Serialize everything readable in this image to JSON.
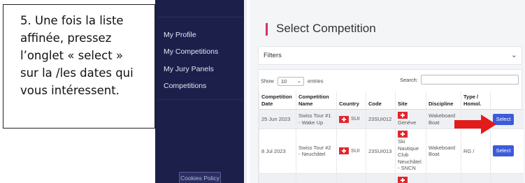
{
  "callout": {
    "lines": [
      "5. Une fois la liste",
      "affinée, pressez",
      "l’onglet « select »",
      "sur la /les dates qui",
      "vous intéressent."
    ]
  },
  "sidebar": {
    "items": [
      {
        "label": "My Profile"
      },
      {
        "label": "My Competitions"
      },
      {
        "label": "My Jury Panels"
      },
      {
        "label": "Competitions"
      }
    ],
    "cookies_label": "Cookies Policy"
  },
  "main": {
    "title": "Select Competition",
    "filters_label": "Filters",
    "show_label": "Show",
    "page_size": "10",
    "entries_label": "entries",
    "search_label": "Search:"
  },
  "table": {
    "headers": [
      "Competition Date",
      "Competition Name",
      "Country",
      "Code",
      "Site",
      "Discipline",
      "Type / Homol.",
      ""
    ],
    "rows": [
      {
        "date": "25 Jun 2023",
        "name": "Swiss Tour #1 - Wake Up",
        "country": "SUI",
        "code": "23SUI012",
        "site": "Genève",
        "discipline": "Wakeboard Boat",
        "type": "",
        "action": "Select"
      },
      {
        "date": "8 Jul 2023",
        "name": "Swiss Tour #2 - Neuchâtel",
        "country": "SUI",
        "code": "23SUI013",
        "site": "Ski Nautique Club Neuchâtel - SNCN",
        "discipline": "Wakeboard Boat",
        "type": "RG /",
        "action": "Select"
      }
    ]
  },
  "colors": {
    "sidebar_bg": "#1b1f4a",
    "accent": "#d0336a",
    "button": "#3d5bd9",
    "arrow": "#e21b1b"
  },
  "icons": {
    "filters_toggle": "chevron-down-icon",
    "country_flag": "swiss-flag-icon",
    "pointer": "red-arrow-icon"
  }
}
